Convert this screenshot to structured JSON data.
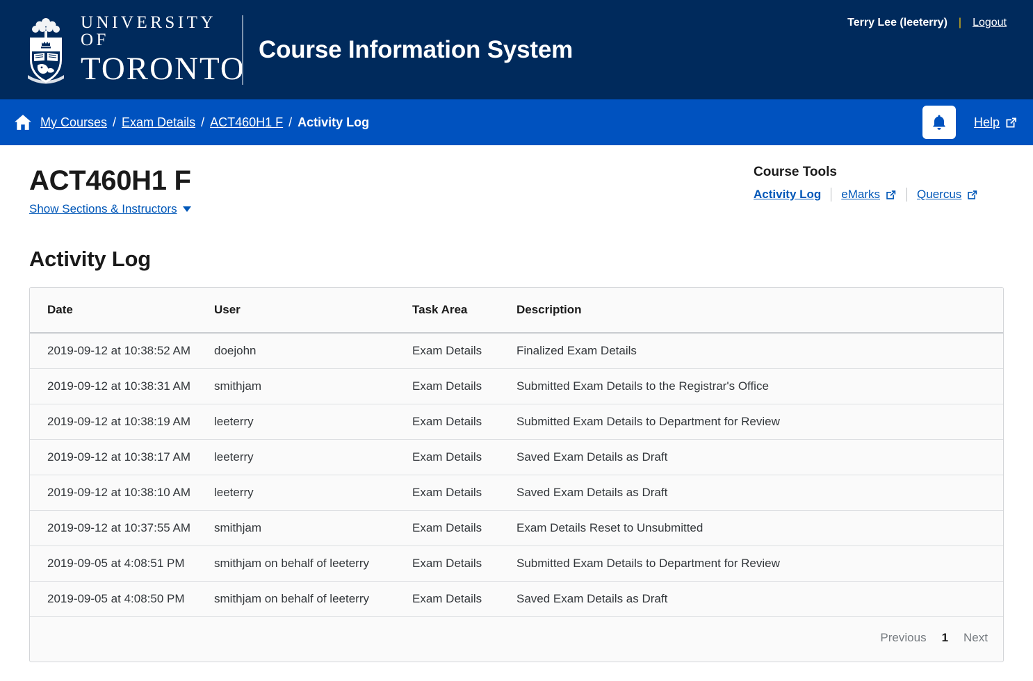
{
  "header": {
    "university_line1": "UNIVERSITY OF",
    "university_line2": "TORONTO",
    "app_title": "Course Information System",
    "user_name": "Terry Lee (leeterry)",
    "user_separator": "|",
    "logout_label": "Logout",
    "background_color": "#002a5c"
  },
  "nav": {
    "home_icon": "home-icon",
    "breadcrumbs": [
      {
        "label": "My Courses",
        "current": false
      },
      {
        "label": "Exam Details",
        "current": false
      },
      {
        "label": "ACT460H1 F",
        "current": false
      },
      {
        "label": "Activity Log",
        "current": true
      }
    ],
    "separator": "/",
    "notifications_icon": "bell-icon",
    "help_label": "Help",
    "help_external_icon": "external-link-icon",
    "background_color": "#0052bf"
  },
  "course": {
    "code": "ACT460H1 F",
    "sections_toggle_label": "Show Sections & Instructors",
    "caret_icon": "chevron-down-icon"
  },
  "course_tools": {
    "title": "Course Tools",
    "links": [
      {
        "label": "Activity Log",
        "active": true,
        "external": false
      },
      {
        "label": "eMarks",
        "active": false,
        "external": true
      },
      {
        "label": "Quercus",
        "active": false,
        "external": true
      }
    ]
  },
  "activity_log": {
    "section_title": "Activity Log",
    "columns": [
      "Date",
      "User",
      "Task Area",
      "Description"
    ],
    "rows": [
      {
        "date": "2019-09-12 at 10:38:52 AM",
        "user": "doejohn",
        "task_area": "Exam Details",
        "description": "Finalized Exam Details"
      },
      {
        "date": "2019-09-12 at 10:38:31 AM",
        "user": "smithjam",
        "task_area": "Exam Details",
        "description": "Submitted Exam Details to the Registrar's Office"
      },
      {
        "date": "2019-09-12 at 10:38:19 AM",
        "user": "leeterry",
        "task_area": "Exam Details",
        "description": "Submitted Exam Details to Department for Review"
      },
      {
        "date": "2019-09-12 at 10:38:17 AM",
        "user": "leeterry",
        "task_area": "Exam Details",
        "description": "Saved Exam Details as Draft"
      },
      {
        "date": "2019-09-12 at 10:38:10 AM",
        "user": "leeterry",
        "task_area": "Exam Details",
        "description": "Saved Exam Details as Draft"
      },
      {
        "date": "2019-09-12 at 10:37:55 AM",
        "user": "smithjam",
        "task_area": "Exam Details",
        "description": "Exam Details Reset to Unsubmitted"
      },
      {
        "date": "2019-09-05 at 4:08:51 PM",
        "user": "smithjam on behalf of leeterry",
        "task_area": "Exam Details",
        "description": "Submitted Exam Details to Department for Review"
      },
      {
        "date": "2019-09-05 at 4:08:50 PM",
        "user": "smithjam on behalf of leeterry",
        "task_area": "Exam Details",
        "description": "Saved Exam Details as Draft"
      }
    ],
    "pagination": {
      "previous_label": "Previous",
      "current_page": "1",
      "next_label": "Next"
    }
  }
}
